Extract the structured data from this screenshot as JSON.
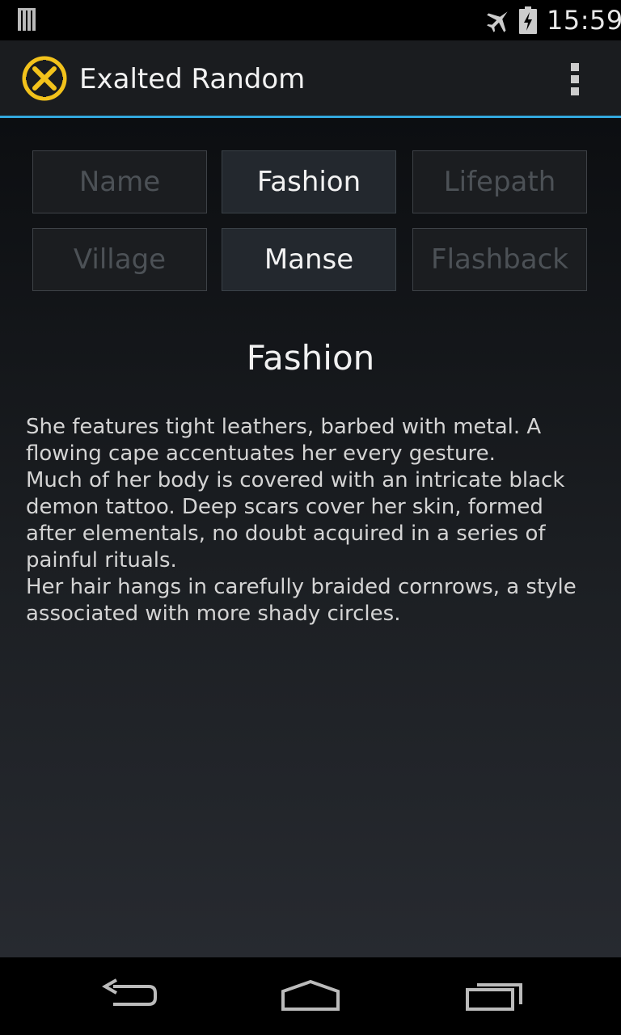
{
  "status_bar": {
    "time": "15:59"
  },
  "app": {
    "title": "Exalted Random"
  },
  "tabs": [
    {
      "label": "Name",
      "active": false
    },
    {
      "label": "Fashion",
      "active": true
    },
    {
      "label": "Lifepath",
      "active": false
    },
    {
      "label": "Village",
      "active": false
    },
    {
      "label": "Manse",
      "active": true
    },
    {
      "label": "Flashback",
      "active": false
    }
  ],
  "section": {
    "title": "Fashion",
    "paragraphs": [
      "She features tight leathers, barbed with metal. A flowing cape accentuates her every gesture.",
      "Much of her body is covered with an intricate black demon tattoo. Deep scars cover her skin, formed after elementals, no doubt acquired in a series of painful rituals.",
      "Her hair hangs in carefully braided cornrows, a style associated with more shady circles."
    ]
  },
  "icons": {
    "logo": "app-logo-icon",
    "overflow": "overflow-menu-icon",
    "back": "back-icon",
    "home": "home-icon",
    "recents": "recent-apps-icon"
  },
  "colors": {
    "accent": "#33a8dd",
    "logo": "#f2c21b"
  }
}
